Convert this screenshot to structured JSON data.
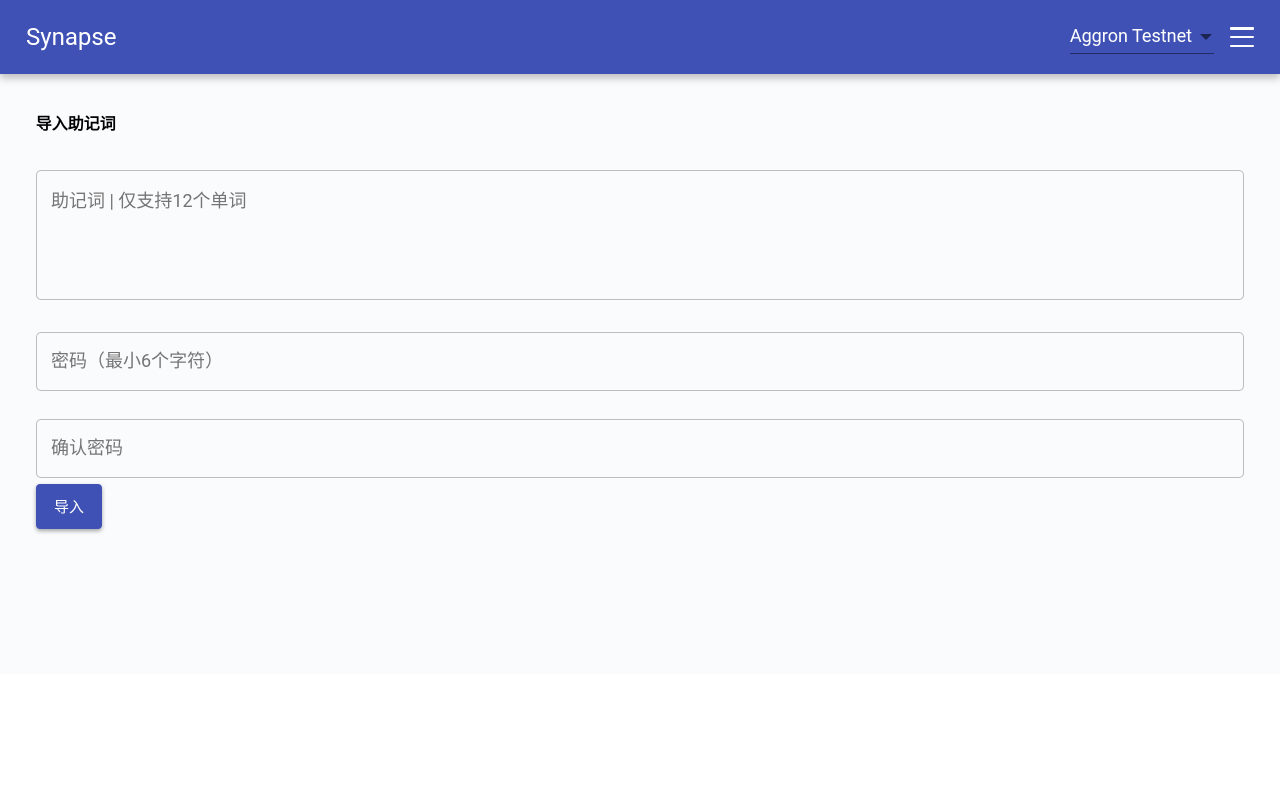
{
  "header": {
    "app_title": "Synapse",
    "network_selected": "Aggron Testnet"
  },
  "page": {
    "title": "导入助记词",
    "mnemonic_placeholder": "助记词 | 仅支持12个单词",
    "password_placeholder": "密码（最小6个字符）",
    "confirm_password_placeholder": "确认密码",
    "import_button_label": "导入"
  },
  "colors": {
    "primary": "#3f51b5",
    "page_bg": "#fafbfd",
    "border": "#bdbdbd",
    "placeholder": "#757575"
  }
}
